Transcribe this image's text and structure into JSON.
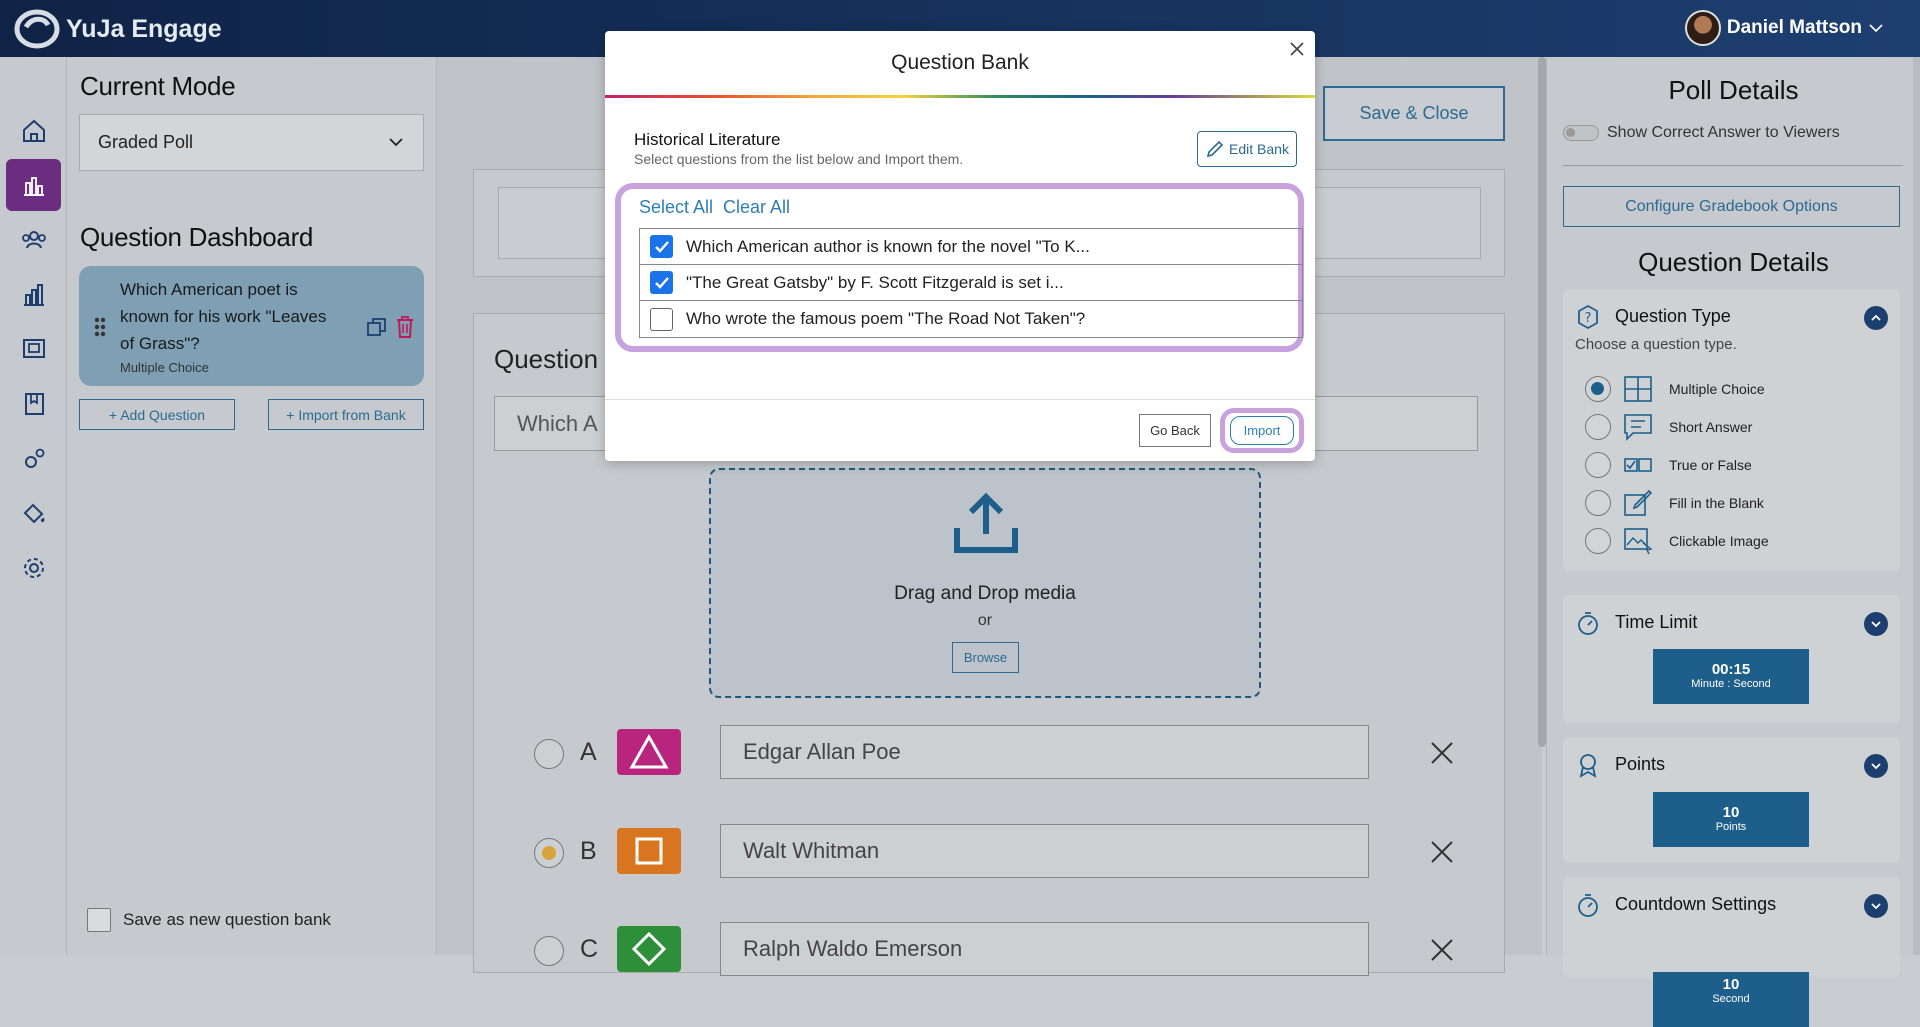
{
  "app": {
    "brand": "YuJa Engage",
    "user_name": "Daniel Mattson"
  },
  "rail": {
    "icons": [
      "home-icon",
      "poll-icon",
      "people-icon",
      "analytics-icon",
      "present-icon",
      "bookmark-icon",
      "settings-gear-icon",
      "paint-icon",
      "gear-icon"
    ]
  },
  "left": {
    "current_mode_title": "Current Mode",
    "mode_value": "Graded Poll",
    "dashboard_title": "Question Dashboard",
    "question_text": "Which American poet is known for his work \"Leaves of Grass\"?",
    "question_type": "Multiple Choice",
    "add_question": "+ Add Question",
    "import_from_bank": "+ Import from Bank",
    "save_as_bank": "Save as new question bank"
  },
  "center": {
    "save_close": "Save & Close",
    "question_label": "Question",
    "question_input": "Which A",
    "drag_drop": "Drag and Drop media",
    "or": "or",
    "browse": "Browse",
    "answers": [
      {
        "letter": "A",
        "text": "Edgar Allan Poe",
        "selected": false,
        "color": "#b8247e"
      },
      {
        "letter": "B",
        "text": "Walt Whitman",
        "selected": true,
        "color": "#d9741f"
      },
      {
        "letter": "C",
        "text": "Ralph Waldo Emerson",
        "selected": false,
        "color": "#2d8f3a"
      }
    ]
  },
  "right": {
    "poll_details": "Poll Details",
    "show_correct": "Show Correct Answer to Viewers",
    "gradebook": "Configure Gradebook Options",
    "question_details": "Question Details",
    "question_type_title": "Question Type",
    "question_type_sub": "Choose a question type.",
    "question_types": [
      {
        "label": "Multiple Choice",
        "selected": true,
        "icon": "grid-icon"
      },
      {
        "label": "Short Answer",
        "selected": false,
        "icon": "speech-icon"
      },
      {
        "label": "True or False",
        "selected": false,
        "icon": "checkbox-icon"
      },
      {
        "label": "Fill in the Blank",
        "selected": false,
        "icon": "edit-icon"
      },
      {
        "label": "Clickable Image",
        "selected": false,
        "icon": "image-cursor-icon"
      }
    ],
    "time_limit_title": "Time Limit",
    "time_value": "00:15",
    "time_unit": "Minute : Second",
    "points_title": "Points",
    "points_value": "10",
    "points_unit": "Points",
    "countdown_title": "Countdown Settings",
    "countdown_value": "10",
    "countdown_unit": "Second"
  },
  "modal": {
    "title": "Question Bank",
    "bank_name": "Historical Literature",
    "bank_sub": "Select questions from the list below and Import them.",
    "edit_bank": "Edit Bank",
    "select_all": "Select All",
    "clear_all": "Clear All",
    "questions": [
      {
        "text": "Which American author is known for the novel \"To K...",
        "checked": true
      },
      {
        "text": "\"The Great Gatsby\" by F. Scott Fitzgerald is set i...",
        "checked": true
      },
      {
        "text": "Who wrote the famous poem \"The Road Not Taken\"?",
        "checked": false
      }
    ],
    "go_back": "Go Back",
    "import": "Import"
  },
  "colors": {
    "accent": "#2d6a92",
    "highlight": "#c8a2dd",
    "rail_active": "#6a2d7f",
    "checkbox": "#1a73e8"
  }
}
